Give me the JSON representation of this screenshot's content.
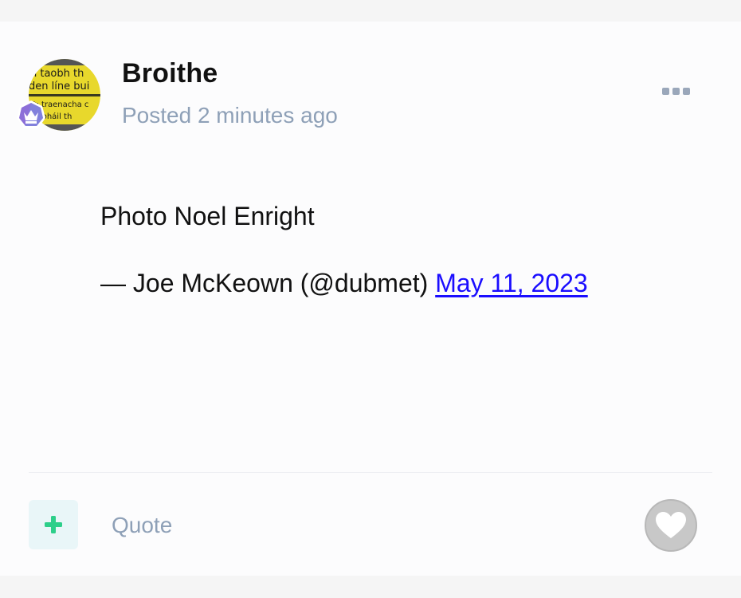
{
  "post": {
    "author": "Broithe",
    "posted": "Posted 2 minutes ago",
    "body_line1": "Photo Noel Enright",
    "attribution": "— Joe McKeown (@dubmet) ",
    "date_link": "May 11, 2023"
  },
  "avatar": {
    "image_text": [
      "n taobh th",
      "den líne bui",
      "ct: traenacha c",
      "gabháil th"
    ]
  },
  "actions": {
    "quote_label": "Quote"
  },
  "icons": {
    "avatar_badge": "crown-badge-icon",
    "menu": "ellipsis-icon",
    "reply": "plus-icon",
    "like": "heart-icon"
  },
  "colors": {
    "meta_text": "#8ea0b7",
    "link": "#1a0dff",
    "plus_icon": "#2dcf8a",
    "badge_purple": "#8c6fd8",
    "like_bg": "#c8c8c8"
  }
}
